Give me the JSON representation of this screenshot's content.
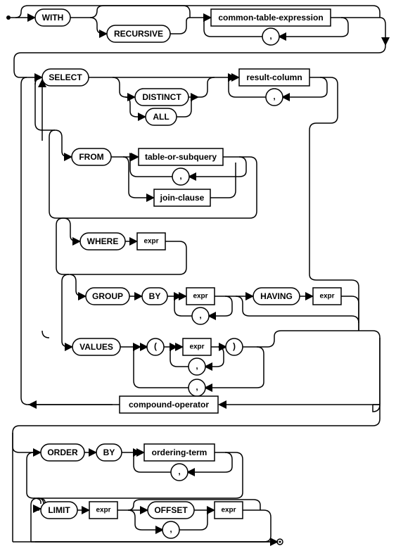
{
  "diagram": {
    "type": "railroad-syntax-diagram",
    "language": "SQL",
    "production": "select-stmt",
    "keywords": {
      "with": "WITH",
      "recursive": "RECURSIVE",
      "select": "SELECT",
      "distinct": "DISTINCT",
      "all": "ALL",
      "from": "FROM",
      "where": "WHERE",
      "group": "GROUP",
      "by": "BY",
      "having": "HAVING",
      "values": "VALUES",
      "order": "ORDER",
      "limit": "LIMIT",
      "offset": "OFFSET"
    },
    "nonterminals": {
      "cte": "common-table-expression",
      "result_column": "result-column",
      "table_or_subquery": "table-or-subquery",
      "join_clause": "join-clause",
      "expr": "expr",
      "compound_operator": "compound-operator",
      "ordering_term": "ordering-term"
    },
    "punct": {
      "comma": ",",
      "lparen": "(",
      "rparen": ")"
    }
  }
}
